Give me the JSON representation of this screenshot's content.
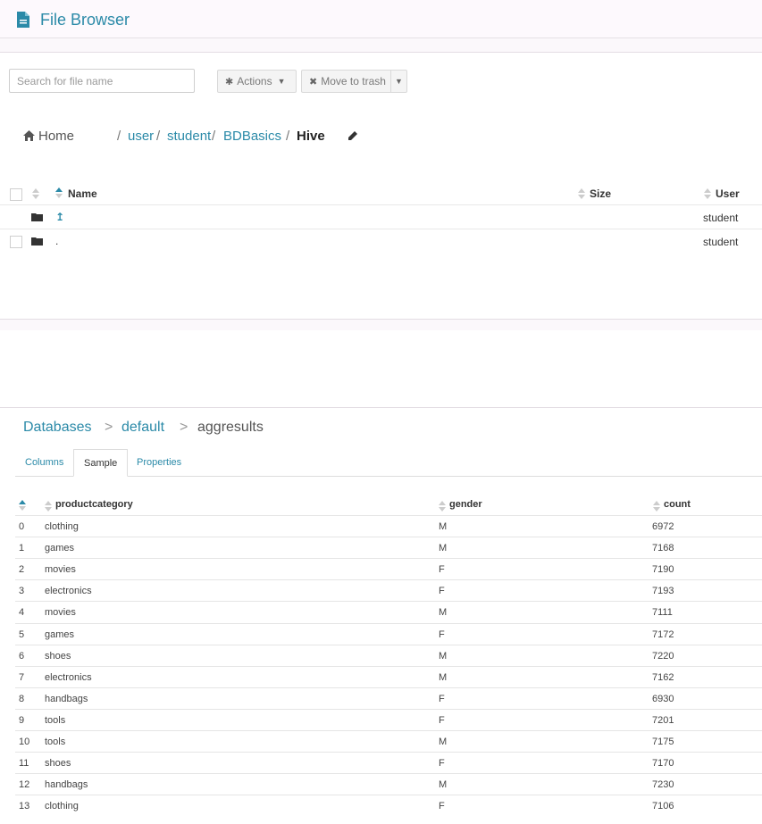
{
  "app": {
    "title": "File Browser"
  },
  "toolbar": {
    "search_placeholder": "Search for file name",
    "actions_label": "Actions",
    "trash_label": "Move to trash"
  },
  "breadcrumb": {
    "home": "Home",
    "parts": [
      "user",
      "student",
      "BDBasics"
    ],
    "separator": "/",
    "current": "Hive"
  },
  "files": {
    "headers": {
      "name": "Name",
      "size": "Size",
      "user": "User"
    },
    "rows": [
      {
        "name": "↥",
        "user": "student"
      },
      {
        "name": ".",
        "user": "student"
      }
    ]
  },
  "db_breadcrumb": {
    "parts": [
      "Databases",
      "default"
    ],
    "separator": ">",
    "current": "aggresults"
  },
  "tabs": [
    {
      "label": "Columns"
    },
    {
      "label": "Sample"
    },
    {
      "label": "Properties"
    }
  ],
  "sample": {
    "headers": [
      "productcategory",
      "gender",
      "count"
    ],
    "rows": [
      [
        "0",
        "clothing",
        "M",
        "6972"
      ],
      [
        "1",
        "games",
        "M",
        "7168"
      ],
      [
        "2",
        "movies",
        "F",
        "7190"
      ],
      [
        "3",
        "electronics",
        "F",
        "7193"
      ],
      [
        "4",
        "movies",
        "M",
        "7111"
      ],
      [
        "5",
        "games",
        "F",
        "7172"
      ],
      [
        "6",
        "shoes",
        "M",
        "7220"
      ],
      [
        "7",
        "electronics",
        "M",
        "7162"
      ],
      [
        "8",
        "handbags",
        "F",
        "6930"
      ],
      [
        "9",
        "tools",
        "F",
        "7201"
      ],
      [
        "10",
        "tools",
        "M",
        "7175"
      ],
      [
        "11",
        "shoes",
        "F",
        "7170"
      ],
      [
        "12",
        "handbags",
        "M",
        "7230"
      ],
      [
        "13",
        "clothing",
        "F",
        "7106"
      ]
    ]
  },
  "colors": {
    "accent": "#2b8aa8",
    "text": "#333333"
  }
}
